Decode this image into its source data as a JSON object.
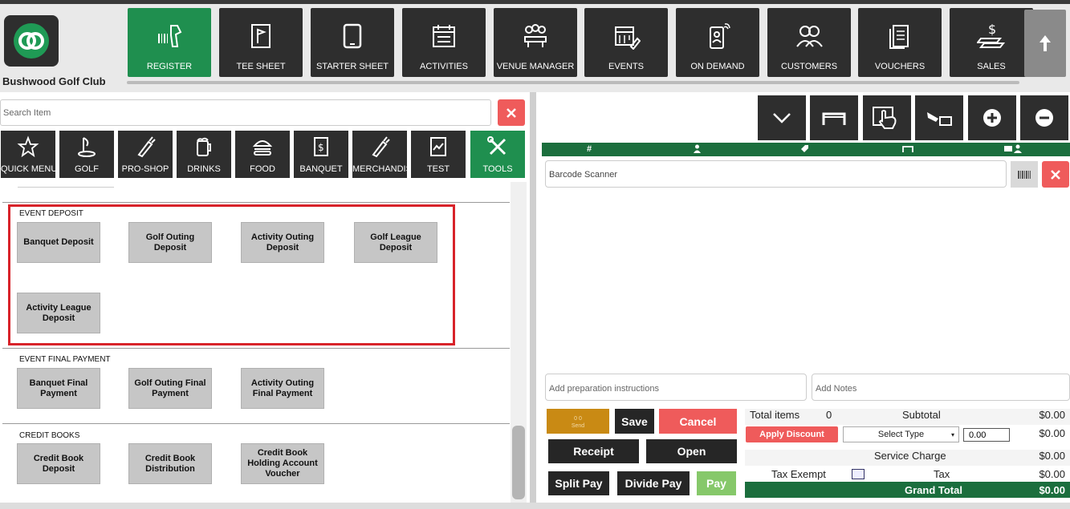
{
  "brand": {
    "name": "Bushwood Golf Club"
  },
  "modules": [
    {
      "label": "REGISTER",
      "icon": "barcode-scanner-icon",
      "active": true
    },
    {
      "label": "TEE SHEET",
      "icon": "tee-sheet-icon"
    },
    {
      "label": "STARTER SHEET",
      "icon": "tablet-icon"
    },
    {
      "label": "ACTIVITIES",
      "icon": "calendar-list-icon"
    },
    {
      "label": "VENUE MANAGER",
      "icon": "meeting-table-icon"
    },
    {
      "label": "EVENTS",
      "icon": "calendar-edit-icon"
    },
    {
      "label": "ON DEMAND",
      "icon": "mobile-order-icon"
    },
    {
      "label": "CUSTOMERS",
      "icon": "people-icon"
    },
    {
      "label": "VOUCHERS",
      "icon": "voucher-icon"
    },
    {
      "label": "SALES",
      "icon": "money-icon"
    }
  ],
  "search": {
    "placeholder": "Search Item"
  },
  "categories": [
    {
      "label": "QUICK MENU",
      "icon": "star-icon"
    },
    {
      "label": "GOLF",
      "icon": "golf-icon"
    },
    {
      "label": "PRO-SHOP",
      "icon": "golf-bag-icon"
    },
    {
      "label": "DRINKS",
      "icon": "beer-mug-icon"
    },
    {
      "label": "FOOD",
      "icon": "burger-icon"
    },
    {
      "label": "BANQUET",
      "icon": "menu-doc-icon"
    },
    {
      "label": "MERCHANDISE",
      "icon": "golf-bag-icon"
    },
    {
      "label": "TEST",
      "icon": "chart-doc-icon"
    },
    {
      "label": "TOOLS",
      "icon": "tools-icon",
      "active": true
    }
  ],
  "sections": [
    {
      "title": "EVENT DEPOSIT",
      "items": [
        "Banquet Deposit",
        "Golf Outing Deposit",
        "Activity Outing Deposit",
        "Golf League Deposit",
        "Activity League Deposit"
      ]
    },
    {
      "title": "EVENT FINAL PAYMENT",
      "items": [
        "Banquet Final Payment",
        "Golf Outing Final Payment",
        "Activity Outing Final Payment"
      ]
    },
    {
      "title": "CREDIT BOOKS",
      "items": [
        "Credit Book Deposit",
        "Credit Book Distribution",
        "Credit Book Holding Account Voucher"
      ]
    }
  ],
  "ticket": {
    "columns": [
      "#",
      "person",
      "tag",
      "table",
      "card-person"
    ],
    "barcode_placeholder": "Barcode Scanner",
    "prep_placeholder": "Add preparation instructions",
    "notes_placeholder": "Add Notes"
  },
  "send": {
    "label": "Send",
    "counts": "0   0"
  },
  "actions": {
    "save": "Save",
    "cancel": "Cancel",
    "receipt": "Receipt",
    "open": "Open",
    "split_pay": "Split Pay",
    "divide_pay": "Divide Pay",
    "pay": "Pay"
  },
  "totals": {
    "total_items_label": "Total items",
    "total_items": "0",
    "subtotal_label": "Subtotal",
    "subtotal": "$0.00",
    "apply_discount": "Apply Discount",
    "select_type": "Select Type",
    "discount_value": "0.00",
    "discount_amount": "$0.00",
    "service_charge_label": "Service Charge",
    "service_charge": "$0.00",
    "tax_exempt_label": "Tax Exempt",
    "tax_label": "Tax",
    "tax": "$0.00",
    "grand_total_label": "Grand Total",
    "grand_total": "$0.00"
  },
  "colors": {
    "dark": "#2e2e2e",
    "green": "#1f8f4f",
    "table_green": "#1b6e3d",
    "red": "#ef5b5b",
    "orange": "#c98a14",
    "pay_green": "#86c86a"
  }
}
